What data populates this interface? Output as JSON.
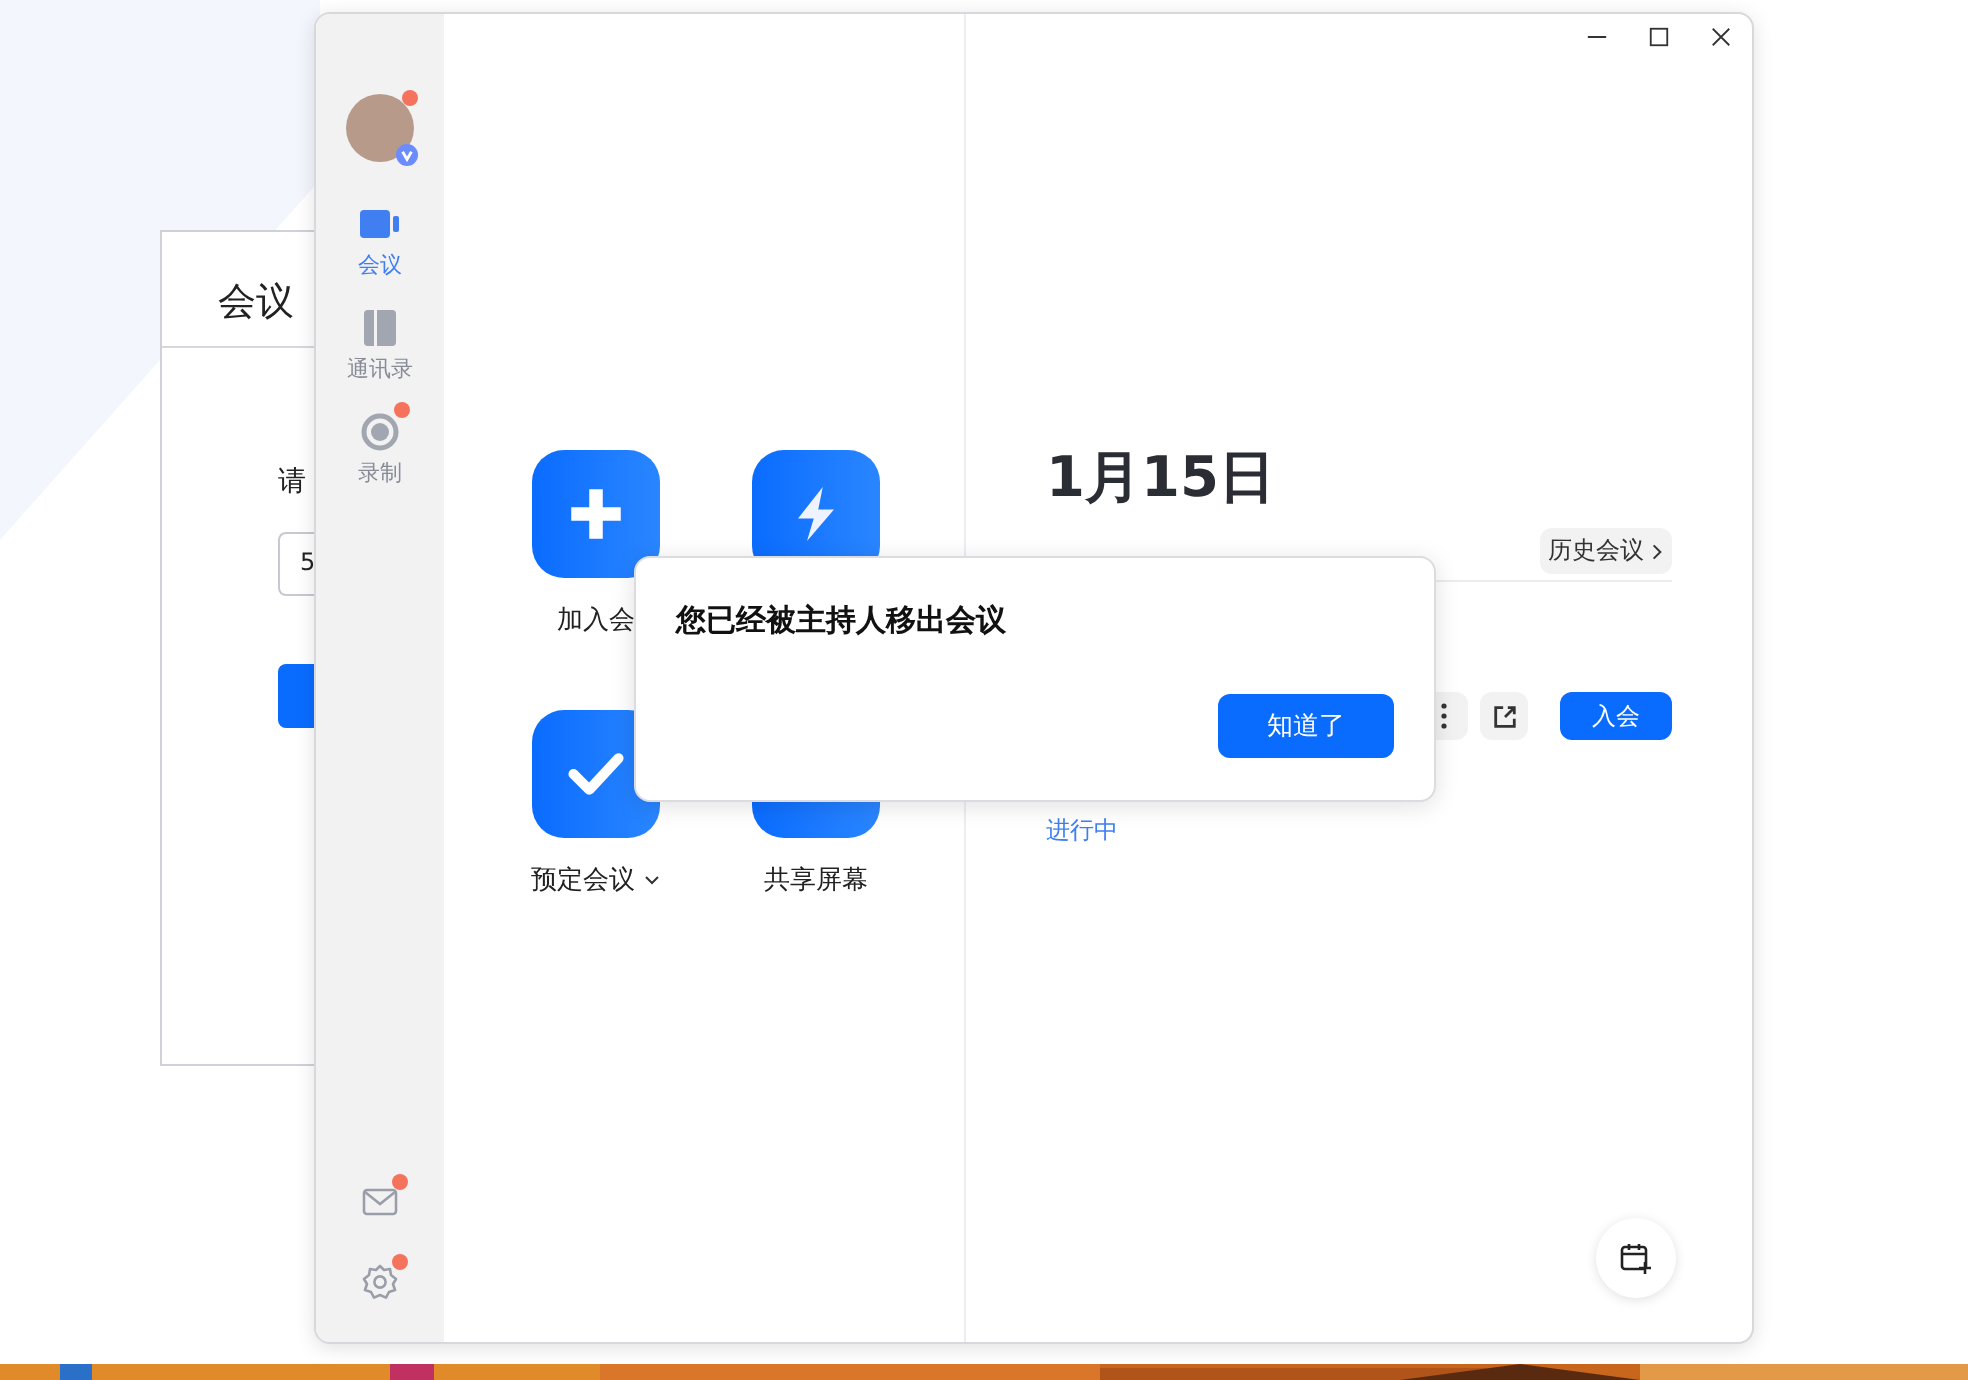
{
  "background_window": {
    "title": "会议",
    "prompt": "请",
    "field_value": "5"
  },
  "sidebar": {
    "avatar": {
      "notification": true,
      "verified": true
    },
    "nav": [
      {
        "label": "会议",
        "kind": "video",
        "selected": true,
        "notification": false
      },
      {
        "label": "通讯录",
        "kind": "book",
        "selected": false,
        "notification": false
      },
      {
        "label": "录制",
        "kind": "record",
        "selected": false,
        "notification": true
      }
    ],
    "bottom": [
      {
        "kind": "mail",
        "notification": true
      },
      {
        "kind": "settings",
        "notification": true
      }
    ]
  },
  "actions": [
    {
      "label": "加入会",
      "kind": "plus",
      "has_menu": false
    },
    {
      "kind": "bolt",
      "has_menu": false
    },
    {
      "label": "预定会议",
      "kind": "check",
      "has_menu": true
    },
    {
      "label": "共享屏幕",
      "kind": "blank",
      "has_menu": false
    }
  ],
  "schedule": {
    "date": "1月15日",
    "history_button": "历史会议",
    "meeting": {
      "status": "进行中",
      "join_button": "入会"
    }
  },
  "dialog": {
    "message": "您已经被主持人移出会议",
    "button": "知道了"
  }
}
